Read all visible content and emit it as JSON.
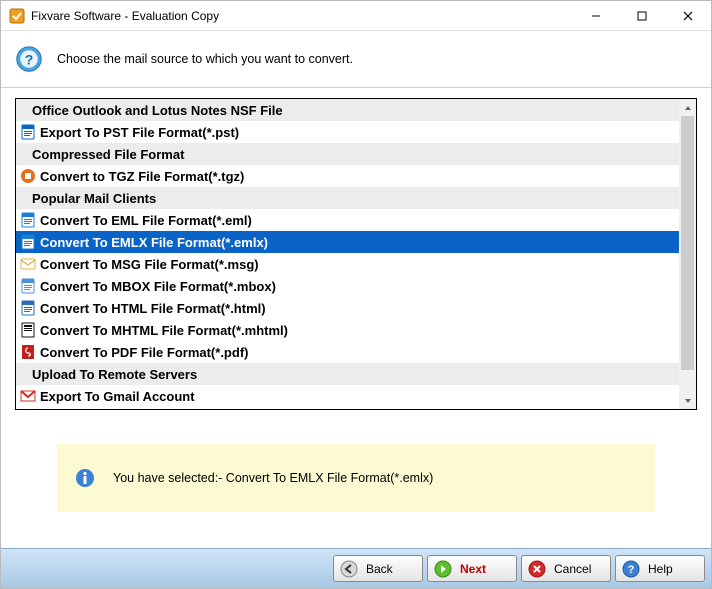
{
  "window": {
    "title": "Fixvare Software - Evaluation Copy"
  },
  "header": {
    "instruction": "Choose the mail source to which you want to convert."
  },
  "list": {
    "rows": [
      {
        "type": "header",
        "label": "Office Outlook and Lotus Notes NSF File"
      },
      {
        "type": "item",
        "icon": "outlook",
        "label": "Export To PST File Format(*.pst)"
      },
      {
        "type": "header",
        "label": "Compressed File Format"
      },
      {
        "type": "item",
        "icon": "tgz",
        "label": "Convert to TGZ File Format(*.tgz)"
      },
      {
        "type": "header",
        "label": "Popular Mail Clients"
      },
      {
        "type": "item",
        "icon": "eml",
        "label": "Convert To EML File Format(*.eml)"
      },
      {
        "type": "item",
        "icon": "emlx",
        "label": "Convert To EMLX File Format(*.emlx)",
        "selected": true
      },
      {
        "type": "item",
        "icon": "msg",
        "label": "Convert To MSG File Format(*.msg)"
      },
      {
        "type": "item",
        "icon": "mbox",
        "label": "Convert To MBOX File Format(*.mbox)"
      },
      {
        "type": "item",
        "icon": "html",
        "label": "Convert To HTML File Format(*.html)"
      },
      {
        "type": "item",
        "icon": "mhtml",
        "label": "Convert To MHTML File Format(*.mhtml)"
      },
      {
        "type": "item",
        "icon": "pdf",
        "label": "Convert To PDF File Format(*.pdf)"
      },
      {
        "type": "header",
        "label": "Upload To Remote Servers"
      },
      {
        "type": "item",
        "icon": "gmail",
        "label": "Export To Gmail Account"
      }
    ]
  },
  "status": {
    "text": "You have selected:- Convert To EMLX File Format(*.emlx)"
  },
  "footer": {
    "back": "Back",
    "next": "Next",
    "cancel": "Cancel",
    "help": "Help"
  },
  "icon_colors": {
    "outlook": "#0a63c6",
    "tgz": "#e86f1a",
    "eml": "#1a7fd4",
    "emlx": "#1a7fd4",
    "msg": "#e0b040",
    "mbox": "#4a90d9",
    "html": "#2a6fb0",
    "mhtml": "#111111",
    "pdf": "#c41e1e",
    "gmail": "#d93025"
  }
}
